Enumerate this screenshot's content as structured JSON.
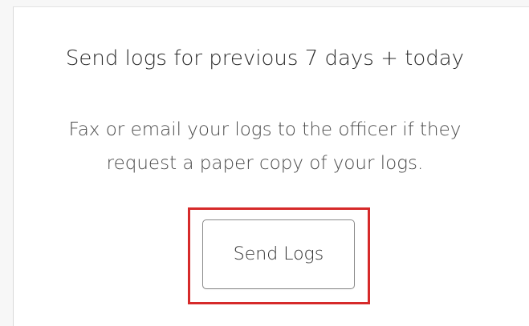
{
  "dialog": {
    "title": "Send logs for previous 7 days + today",
    "description_line1": "Fax or email your logs to the officer if they",
    "description_line2": "request a paper copy of your logs.",
    "send_button_label": "Send Logs"
  },
  "colors": {
    "highlight_border": "#d62a2a",
    "button_border": "#8a8a8a",
    "title_text": "#2a2a2a"
  }
}
